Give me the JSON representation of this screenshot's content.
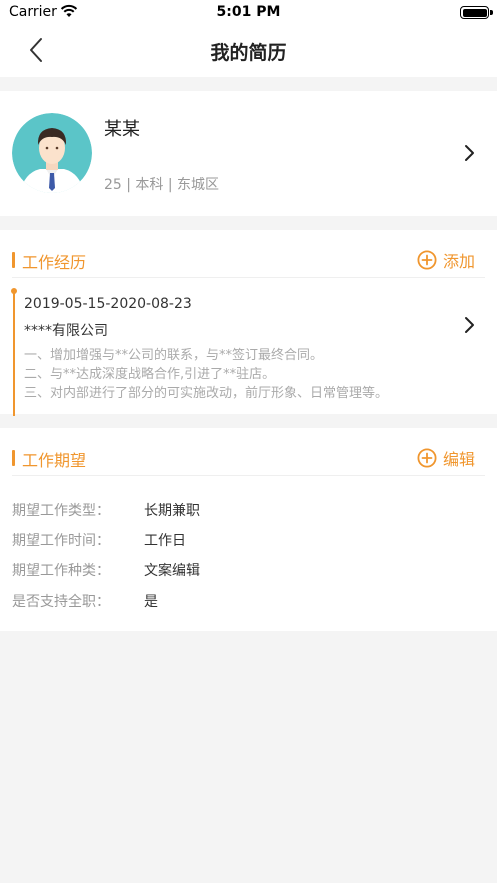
{
  "status_bar": {
    "carrier": "Carrier",
    "time": "5:01 PM"
  },
  "nav": {
    "title": "我的简历"
  },
  "profile": {
    "name": "某某",
    "meta": "25 | 本科 | 东城区"
  },
  "work_experience": {
    "title": "工作经历",
    "action_label": "添加",
    "items": [
      {
        "date_range": "2019-05-15-2020-08-23",
        "company": "****有限公司",
        "descriptions": [
          "一、增加增强与**公司的联系，与**签订最终合同。",
          "二、与**达成深度战略合作,引进了**驻店。",
          "三、对内部进行了部分的可实施改动，前厅形象、日常管理等。"
        ]
      }
    ]
  },
  "job_expectations": {
    "title": "工作期望",
    "action_label": "编辑",
    "rows": [
      {
        "label": "期望工作类型：",
        "value": "长期兼职"
      },
      {
        "label": "期望工作时间：",
        "value": "工作日"
      },
      {
        "label": "期望工作种类：",
        "value": "文案编辑"
      },
      {
        "label": "是否支持全职：",
        "value": "是"
      }
    ]
  },
  "colors": {
    "accent": "#f0962e",
    "background": "#f4f4f4",
    "avatar_bg": "#5bc5c8"
  }
}
